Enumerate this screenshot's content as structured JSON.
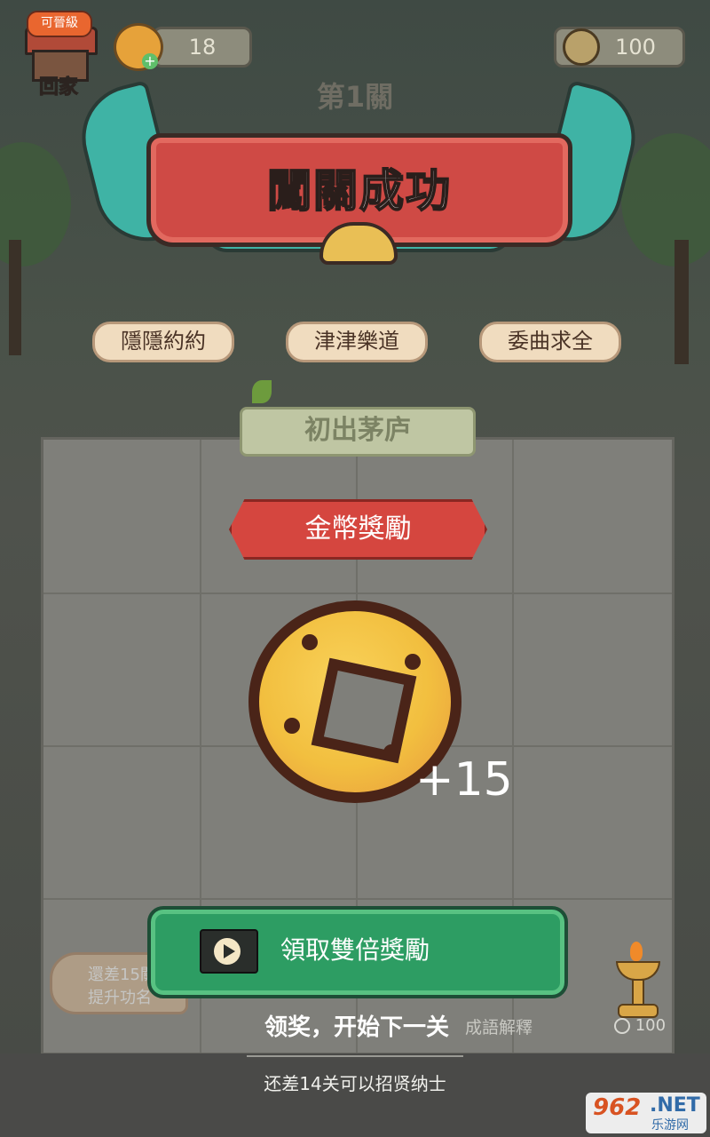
{
  "header": {
    "home_tag": "可晉級",
    "home_label": "回家",
    "fruit_count": "18",
    "coin_count": "100",
    "level_title": "第1關"
  },
  "banner": {
    "title": "闖關成功"
  },
  "idioms": [
    "隱隱約約",
    "津津樂道",
    "委曲求全"
  ],
  "board": {
    "rank_title": "初出茅庐",
    "reward_title": "金幣獎勵",
    "reward_amount": "+15",
    "double_button": "領取雙倍獎勵",
    "hint_left_line1": "還差15關",
    "hint_left_line2": "提升功名",
    "next_label": "领奖，开始下一关",
    "explain_label": "成語解釋",
    "lamp_cost": "100"
  },
  "footer": {
    "text": "还差14关可以招贤纳士"
  },
  "watermark": {
    "number": "962",
    "net": ".NET",
    "cn": "乐游网"
  },
  "colors": {
    "banner_red": "#cf4a45",
    "ribbon_teal": "#3fb3a5",
    "button_green": "#2d9d63",
    "coin_gold": "#f2bf3f"
  }
}
